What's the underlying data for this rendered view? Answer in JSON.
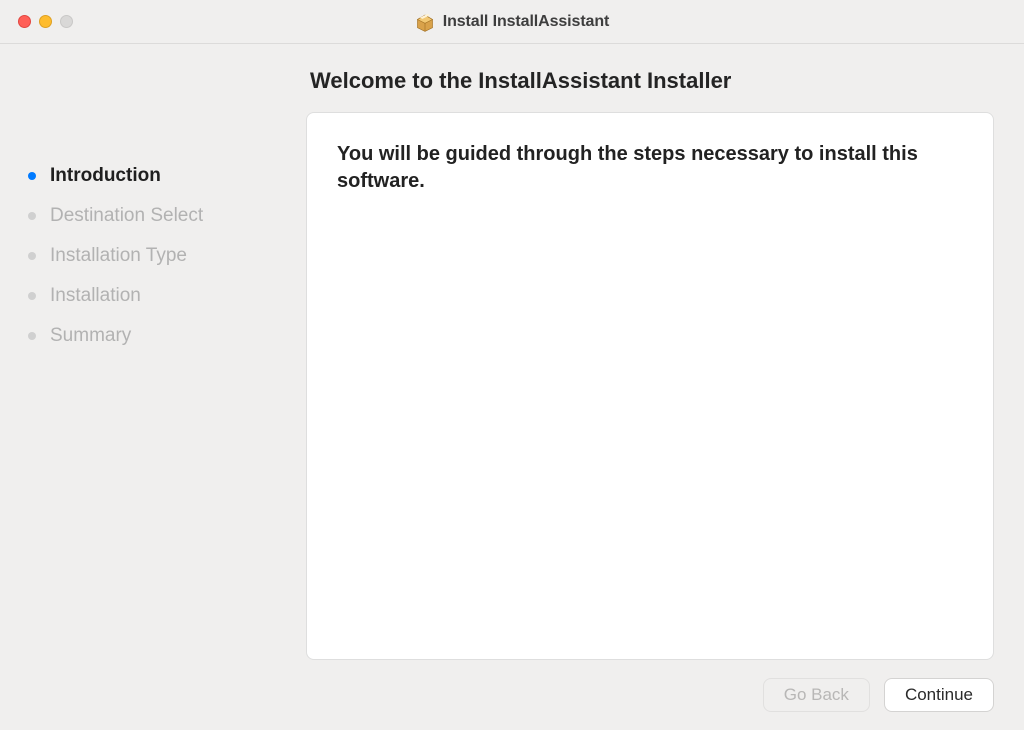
{
  "titlebar": {
    "title": "Install InstallAssistant"
  },
  "sidebar": {
    "steps": [
      {
        "label": "Introduction",
        "active": true
      },
      {
        "label": "Destination Select",
        "active": false
      },
      {
        "label": "Installation Type",
        "active": false
      },
      {
        "label": "Installation",
        "active": false
      },
      {
        "label": "Summary",
        "active": false
      }
    ]
  },
  "main": {
    "heading": "Welcome to the InstallAssistant Installer",
    "body_text": "You will be guided through the steps necessary to install this software."
  },
  "footer": {
    "go_back_label": "Go Back",
    "continue_label": "Continue"
  }
}
